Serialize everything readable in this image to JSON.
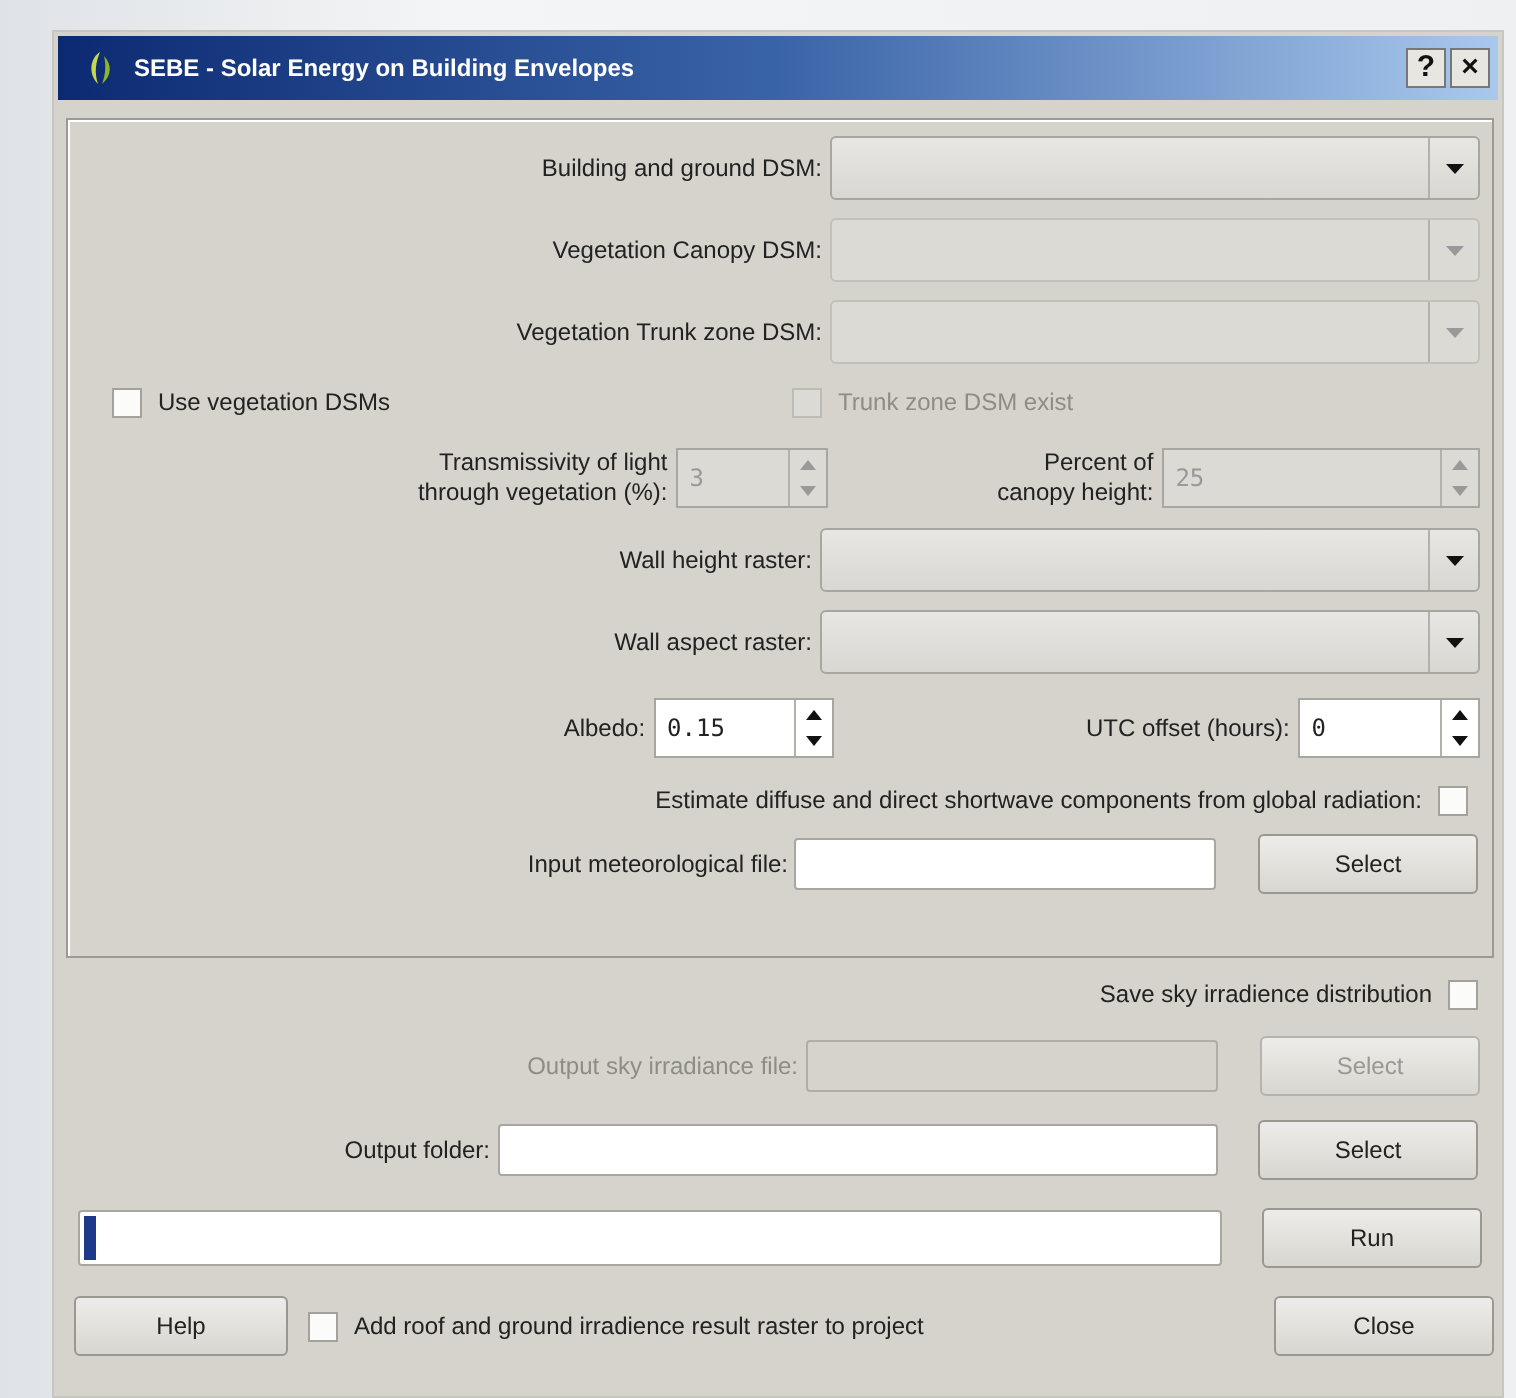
{
  "window": {
    "title": "SEBE - Solar Energy on Building Envelopes",
    "help_glyph": "?",
    "close_glyph": "×"
  },
  "raster_inputs": [
    {
      "label": "Building and ground DSM:",
      "disabled": false
    },
    {
      "label": "Vegetation Canopy DSM:",
      "disabled": true
    },
    {
      "label": "Vegetation Trunk zone DSM:",
      "disabled": true
    }
  ],
  "vegetation_options": [
    {
      "label": "Use vegetation DSMs",
      "checked": false,
      "disabled": false
    },
    {
      "label": "Trunk zone DSM exist",
      "checked": false,
      "disabled": true
    }
  ],
  "vegetation_spinboxes": [
    {
      "label": "Transmissivity of light\nthrough vegetation (%):",
      "value": "3",
      "disabled": true
    },
    {
      "label": "Percent of\ncanopy height:",
      "value": "25",
      "disabled": true
    }
  ],
  "wall_inputs": [
    {
      "label": "Wall height raster:",
      "disabled": false
    },
    {
      "label": "Wall aspect raster:",
      "disabled": false
    }
  ],
  "parameter_spinboxes": [
    {
      "label": "Albedo:",
      "value": "0.15",
      "disabled": false
    },
    {
      "label": "UTC offset (hours):",
      "value": "0",
      "disabled": false
    }
  ],
  "estimate_option": {
    "label": "Estimate diffuse and direct shortwave components from global radiation:",
    "checked": false
  },
  "met_file": {
    "label": "Input meteorological file:",
    "button": "Select",
    "disabled": false
  },
  "save_sky": {
    "label": "Save sky irradience distribution",
    "checked": false
  },
  "sky_file": {
    "label": "Output sky irradiance file:",
    "button": "Select",
    "disabled": true
  },
  "output_folder": {
    "label": "Output folder:",
    "button": "Select",
    "disabled": false
  },
  "progress": {
    "level": 0.01
  },
  "run_button": "Run",
  "help_button": "Help",
  "add_to_project": {
    "label": "Add roof and ground irradience result raster to project",
    "checked": false
  },
  "close_button": "Close"
}
